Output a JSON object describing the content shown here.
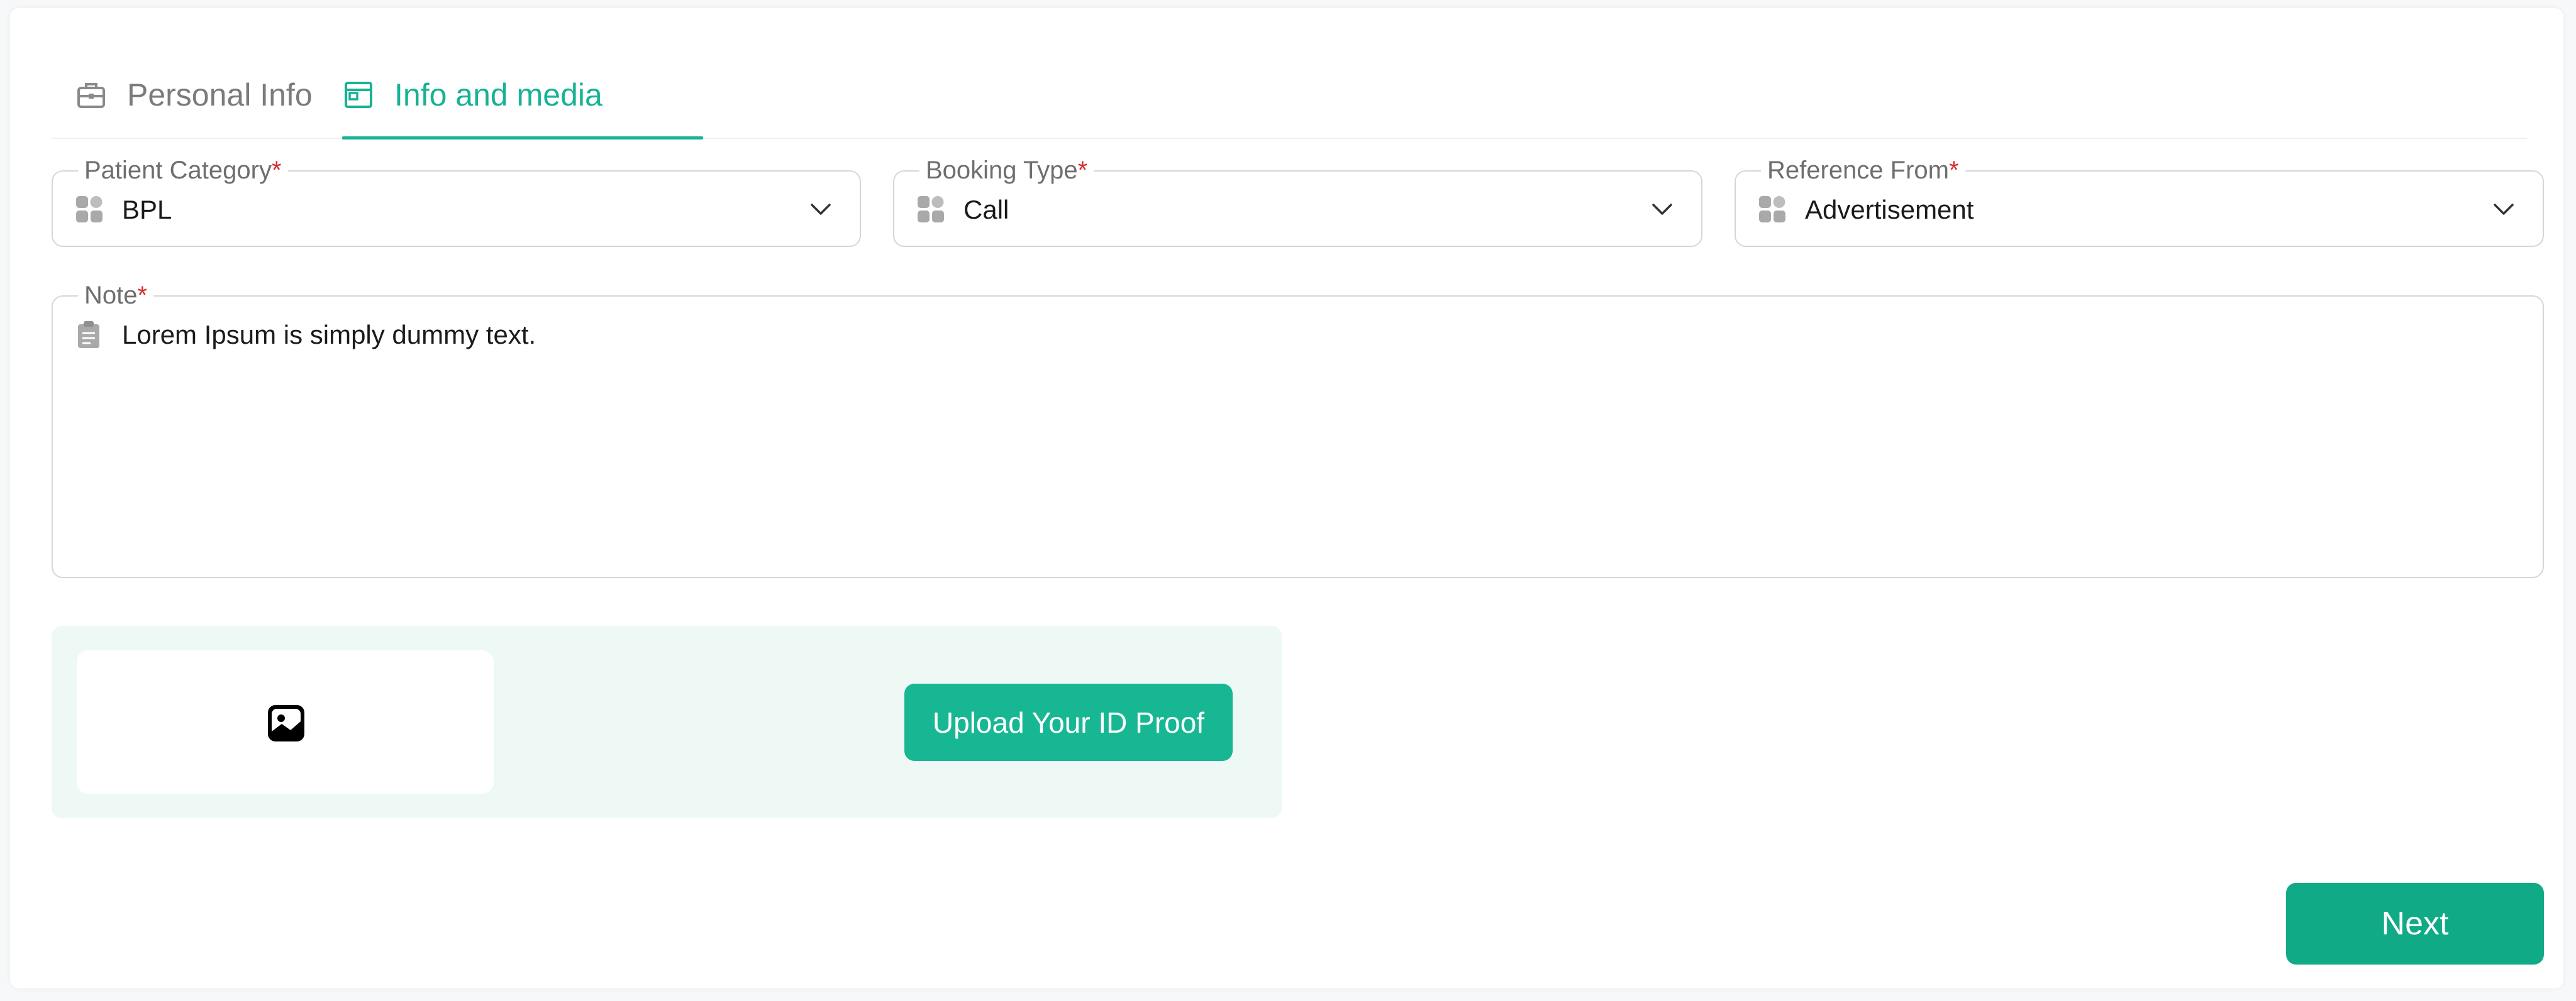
{
  "tabs": [
    {
      "label": "Personal Info",
      "icon": "briefcase-icon",
      "active": false
    },
    {
      "label": "Info and media",
      "icon": "window-icon",
      "active": true
    }
  ],
  "fields": {
    "patient_category": {
      "label": "Patient Category",
      "required_mark": "*",
      "value": "BPL",
      "icon": "grid-icon"
    },
    "booking_type": {
      "label": "Booking Type",
      "required_mark": "*",
      "value": "Call",
      "icon": "grid-icon"
    },
    "reference_from": {
      "label": "Reference From",
      "required_mark": "*",
      "value": "Advertisement",
      "icon": "grid-icon"
    },
    "note": {
      "label": "Note",
      "required_mark": "*",
      "value": "Lorem Ipsum is simply dummy text.",
      "icon": "clipboard-icon"
    }
  },
  "upload": {
    "button_label": "Upload Your ID Proof",
    "preview_icon": "image-icon"
  },
  "actions": {
    "next_label": "Next"
  },
  "colors": {
    "accent": "#17b294",
    "button": "#18b794",
    "next_button": "#10aa86",
    "required": "#d42c2c",
    "upload_panel_bg": "#eef9f6"
  }
}
